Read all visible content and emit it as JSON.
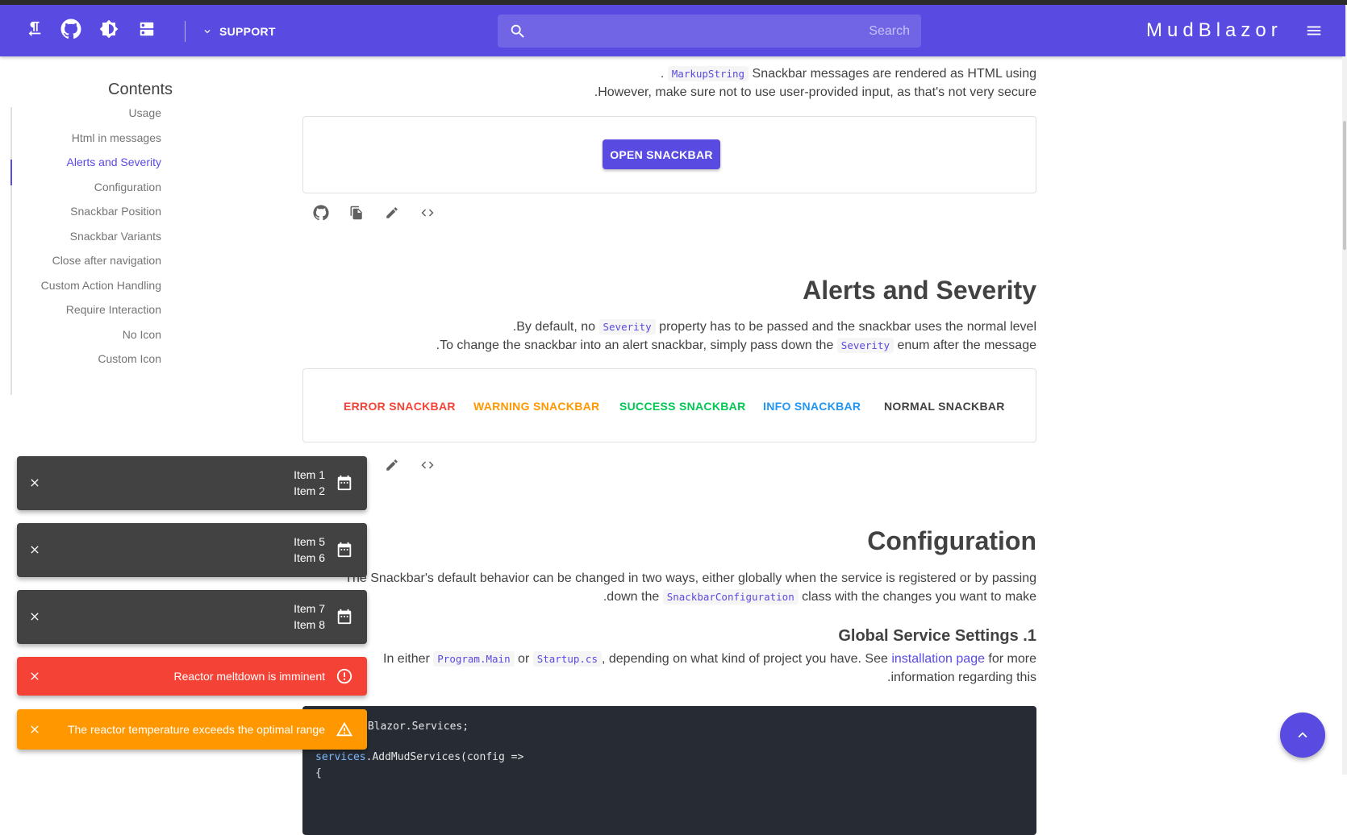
{
  "appbar": {
    "support_label": "SUPPORT",
    "search_placeholder": "Search",
    "brand": "MudBlazor"
  },
  "toc": {
    "title": "Contents",
    "items": [
      {
        "label": "Usage"
      },
      {
        "label": "Html in messages"
      },
      {
        "label": "Alerts and Severity"
      },
      {
        "label": "Configuration"
      },
      {
        "label": "Snackbar Position"
      },
      {
        "label": "Snackbar Variants"
      },
      {
        "label": "Close after navigation"
      },
      {
        "label": "Custom Action Handling"
      },
      {
        "label": "Require Interaction"
      },
      {
        "label": "No Icon"
      },
      {
        "label": "Custom Icon"
      }
    ],
    "active": "Alerts and Severity"
  },
  "html_section": {
    "line1_pre": ". ",
    "line1_code": "MarkupString",
    "line1_post": " Snackbar messages are rendered as HTML using",
    "line2": ".However, make sure not to use user-provided input, as that's not very secure",
    "button": "OPEN SNACKBAR"
  },
  "alerts_section": {
    "title": "Alerts and Severity",
    "line1_pre": ".By default, no ",
    "line1_code": "Severity",
    "line1_post": " property has to be passed and the snackbar uses the normal level",
    "line2_pre": ".To change the snackbar into an alert snackbar, simply pass down the ",
    "line2_code": "Severity",
    "line2_post": " enum after the message",
    "buttons": {
      "error": "ERROR SNACKBAR",
      "warning": "WARNING SNACKBAR",
      "success": "SUCCESS SNACKBAR",
      "info": "INFO SNACKBAR",
      "normal": "NORMAL SNACKBAR"
    }
  },
  "config_section": {
    "title": "Configuration",
    "line1": "The Snackbar's default behavior can be changed in two ways, either globally when the service is registered or by passing",
    "line2_pre": ".down the ",
    "line2_code": "SnackbarConfiguration",
    "line2_post": " class with the changes you want to make",
    "subtitle": "Global Service Settings .1",
    "line3_pre": "In either ",
    "line3_code1": "Program.Main",
    "line3_mid": " or ",
    "line3_code2": "Startup.cs",
    "line3_post": ", depending on what kind of project you have. See ",
    "line3_link": "installation page",
    "line3_end": " for more",
    "line4": ".information regarding this",
    "code_line1": "dBlazor.Services;",
    "code_line2_obj": "services",
    "code_line2_rest": ".AddMudServices(config =>",
    "code_line3": "{"
  },
  "snackbars": [
    {
      "type": "dark",
      "line1": "Item 1",
      "line2": "Item 2",
      "icon": "calendar-icon"
    },
    {
      "type": "dark",
      "line1": "Item 5",
      "line2": "Item 6",
      "icon": "calendar-icon"
    },
    {
      "type": "dark",
      "line1": "Item 7",
      "line2": "Item 8",
      "icon": "calendar-icon"
    },
    {
      "type": "error",
      "message": "Reactor meltdown is imminent",
      "icon": "error-outline-icon"
    },
    {
      "type": "warning",
      "message": "The reactor temperature exceeds the optimal range",
      "icon": "warning-icon"
    }
  ],
  "colors": {
    "primary": "#594ae2",
    "error": "#f44336",
    "warning": "#ff9800",
    "success": "#00c853",
    "info": "#2196f3",
    "dark_snackbar": "#424242"
  }
}
